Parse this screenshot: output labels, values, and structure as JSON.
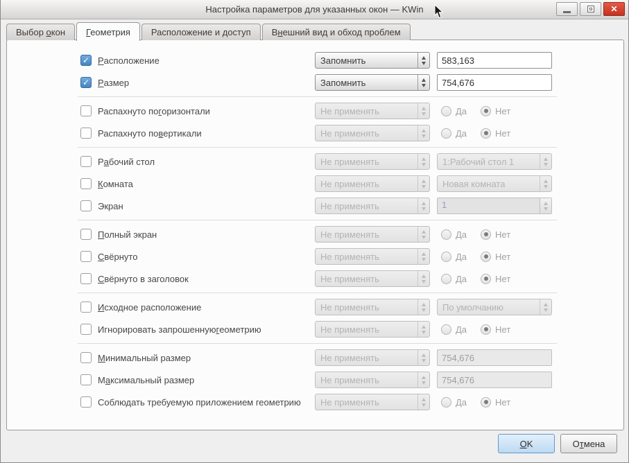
{
  "window": {
    "title": "Настройка параметров для указанных окон — KWin",
    "close_glyph": "✕"
  },
  "tabs": [
    {
      "pre": "Выбор ",
      "accel": "о",
      "post": "кон"
    },
    {
      "pre": "",
      "accel": "Г",
      "post": "еометрия"
    },
    {
      "pre": "Расположение и доступ",
      "accel": "",
      "post": ""
    },
    {
      "pre": "В",
      "accel": "н",
      "post": "ешний вид и обход проблем"
    }
  ],
  "labels": {
    "yes": "Да",
    "no": "Нет"
  },
  "rows": [
    {
      "label_pre": "",
      "label_accel": "Р",
      "label_post": "асположение",
      "combo": "Запомнить",
      "value": "583,163"
    },
    {
      "label_pre": "",
      "label_accel": "Р",
      "label_post": "азмер",
      "combo": "Запомнить",
      "value": "754,676"
    },
    {
      "label_pre": "Распахнуто по ",
      "label_accel": "г",
      "label_post": "оризонтали",
      "combo": "Не применять"
    },
    {
      "label_pre": "Распахнуто по ",
      "label_accel": "в",
      "label_post": "ертикали",
      "combo": "Не применять"
    },
    {
      "label_pre": "Р",
      "label_accel": "а",
      "label_post": "бочий стол",
      "combo": "Не применять",
      "combo2": "1:Рабочий стол 1"
    },
    {
      "label_pre": "",
      "label_accel": "К",
      "label_post": "омната",
      "combo": "Не применять",
      "combo2": "Новая комната"
    },
    {
      "label_pre": "Экран",
      "label_accel": "",
      "label_post": "",
      "combo": "Не применять",
      "spin": "1"
    },
    {
      "label_pre": "",
      "label_accel": "П",
      "label_post": "олный экран",
      "combo": "Не применять"
    },
    {
      "label_pre": "",
      "label_accel": "С",
      "label_post": "вёрнуто",
      "combo": "Не применять"
    },
    {
      "label_pre": "",
      "label_accel": "С",
      "label_post": "вёрнуто в заголовок",
      "combo": "Не применять"
    },
    {
      "label_pre": "",
      "label_accel": "И",
      "label_post": "сходное расположение",
      "combo": "Не применять",
      "combo2": "По умолчанию"
    },
    {
      "label_pre": "Игнорировать запрошенную ",
      "label_accel": "г",
      "label_post": "еометрию",
      "combo": "Не применять"
    },
    {
      "label_pre": "",
      "label_accel": "М",
      "label_post": "инимальный размер",
      "combo": "Не применять",
      "value": "754,676"
    },
    {
      "label_pre": "М",
      "label_accel": "а",
      "label_post": "ксимальный размер",
      "combo": "Не применять",
      "value": "754,676"
    },
    {
      "label_pre": "Соблюдать требуемую приложением геометрию",
      "label_accel": "",
      "label_post": "",
      "combo": "Не применять"
    }
  ],
  "buttons": {
    "ok_pre": "",
    "ok_accel": "O",
    "ok_post": "K",
    "cancel_pre": "О",
    "cancel_accel": "т",
    "cancel_post": "мена"
  }
}
